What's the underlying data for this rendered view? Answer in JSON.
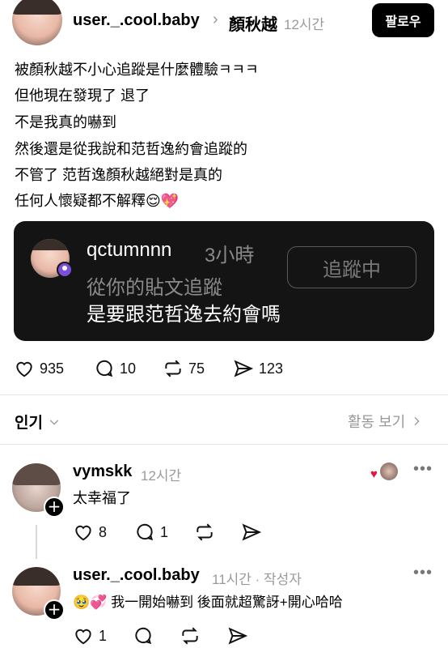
{
  "post": {
    "username": "user._.cool.baby",
    "arrow": "›",
    "topic": "顏秋越",
    "time": "12시간",
    "follow_label": "팔로우",
    "lines": [
      "被顏秋越不小心追蹤是什麼體驗ㅋㅋㅋ",
      "但他現在發現了 退了",
      "不是我真的嚇到",
      "然後還是從我說和范哲逸約會追蹤的",
      "不管了 范哲逸顏秋越絕對是真的",
      "任何人懷疑都不解釋"
    ],
    "last_line_emojis": "😌💖",
    "stats": {
      "likes": "935",
      "comments": "10",
      "reposts": "75",
      "shares": "123"
    }
  },
  "quote": {
    "username": "qctumnnn",
    "time": "3小時",
    "subtitle": "從你的貼文追蹤",
    "body": "是要跟范哲逸去約會嗎",
    "button": "追蹤中"
  },
  "sort": {
    "label": "인기",
    "activity": "활동 보기"
  },
  "replies": [
    {
      "username": "vymskk",
      "time": "12시간",
      "text": "太幸福了",
      "likes": "8",
      "comments": "1"
    },
    {
      "username": "user._.cool.baby",
      "time": "11시간 · 작성자",
      "emojis": "🥹💞",
      "text": "我一開始嚇到 後面就超驚訝+開心哈哈",
      "likes": "1"
    }
  ]
}
